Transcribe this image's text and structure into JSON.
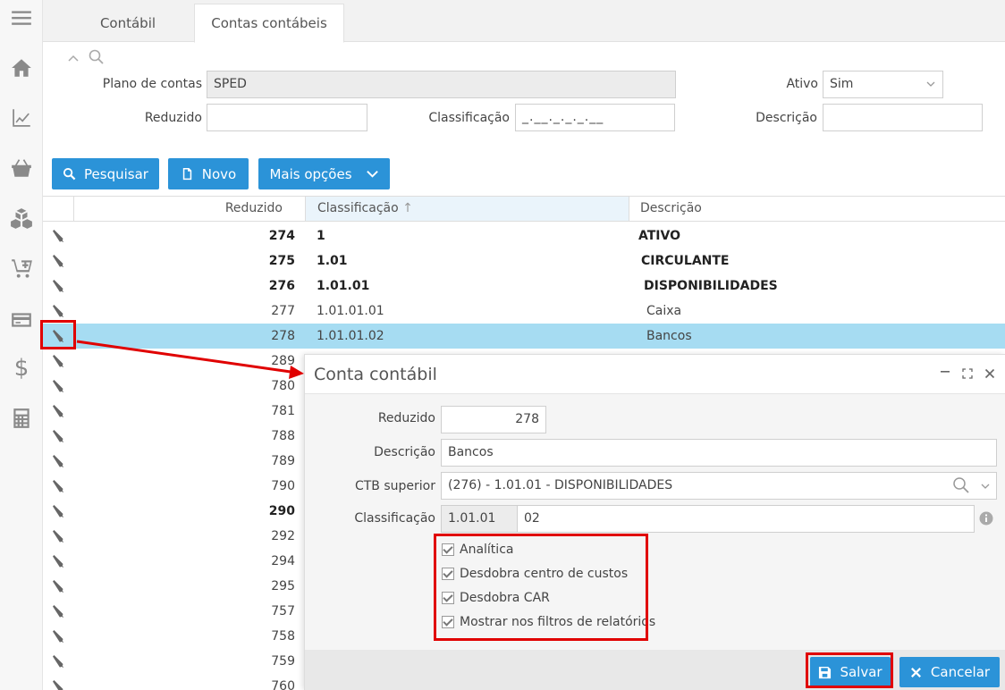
{
  "tabs": [
    {
      "label": "Contábil",
      "active": false
    },
    {
      "label": "Contas contábeis",
      "active": true
    }
  ],
  "filters": {
    "plano_label": "Plano de contas",
    "plano_value": "SPED",
    "ativo_label": "Ativo",
    "ativo_value": "Sim",
    "reduzido_label": "Reduzido",
    "reduzido_value": "",
    "classificacao_label": "Classificação",
    "classificacao_value": "_.__._._._.__",
    "descricao_label": "Descrição",
    "descricao_value": ""
  },
  "toolbar": {
    "pesquisar": "Pesquisar",
    "novo": "Novo",
    "mais_opcoes": "Mais opções"
  },
  "grid": {
    "columns": [
      "Reduzido",
      "Classificação",
      "Descrição"
    ],
    "sort_indicator": "↑",
    "rows": [
      {
        "reduzido": "274",
        "classificacao": "1",
        "descricao": "ATIVO",
        "bold": true,
        "indent": 0
      },
      {
        "reduzido": "275",
        "classificacao": "1.01",
        "descricao": "CIRCULANTE",
        "bold": true,
        "indent": 1
      },
      {
        "reduzido": "276",
        "classificacao": "1.01.01",
        "descricao": "DISPONIBILIDADES",
        "bold": true,
        "indent": 2
      },
      {
        "reduzido": "277",
        "classificacao": "1.01.01.01",
        "descricao": "Caixa",
        "bold": false,
        "indent": 3
      },
      {
        "reduzido": "278",
        "classificacao": "1.01.01.02",
        "descricao": "Bancos",
        "bold": false,
        "indent": 3,
        "selected": true
      },
      {
        "reduzido": "289",
        "classificacao": "",
        "descricao": "",
        "bold": false
      },
      {
        "reduzido": "780",
        "classificacao": "",
        "descricao": "",
        "bold": false
      },
      {
        "reduzido": "781",
        "classificacao": "",
        "descricao": "",
        "bold": false
      },
      {
        "reduzido": "788",
        "classificacao": "",
        "descricao": "",
        "bold": false
      },
      {
        "reduzido": "789",
        "classificacao": "",
        "descricao": "",
        "bold": false
      },
      {
        "reduzido": "790",
        "classificacao": "",
        "descricao": "",
        "bold": false
      },
      {
        "reduzido": "290",
        "classificacao": "",
        "descricao": "",
        "bold": true
      },
      {
        "reduzido": "292",
        "classificacao": "",
        "descricao": "",
        "bold": false
      },
      {
        "reduzido": "294",
        "classificacao": "",
        "descricao": "",
        "bold": false
      },
      {
        "reduzido": "295",
        "classificacao": "",
        "descricao": "",
        "bold": false
      },
      {
        "reduzido": "757",
        "classificacao": "",
        "descricao": "",
        "bold": false
      },
      {
        "reduzido": "758",
        "classificacao": "",
        "descricao": "",
        "bold": false
      },
      {
        "reduzido": "759",
        "classificacao": "",
        "descricao": "",
        "bold": false
      },
      {
        "reduzido": "760",
        "classificacao": "",
        "descricao": "",
        "bold": false
      }
    ]
  },
  "modal": {
    "title": "Conta contábil",
    "reduzido_label": "Reduzido",
    "reduzido_value": "278",
    "descricao_label": "Descrição",
    "descricao_value": "Bancos",
    "ctb_label": "CTB superior",
    "ctb_value": "(276) - 1.01.01 - DISPONIBILIDADES",
    "classificacao_label": "Classificação",
    "classificacao_prefix": "1.01.01",
    "classificacao_value": "02",
    "checks": [
      {
        "label": "Analítica",
        "checked": true
      },
      {
        "label": "Desdobra centro de custos",
        "checked": true
      },
      {
        "label": "Desdobra CAR",
        "checked": true
      },
      {
        "label": "Mostrar nos filtros de relatórios",
        "checked": true
      }
    ],
    "salvar": "Salvar",
    "cancelar": "Cancelar"
  },
  "colors": {
    "accent": "#2b93d8",
    "selected_row": "#a6dcf2",
    "highlight": "#e00000"
  }
}
